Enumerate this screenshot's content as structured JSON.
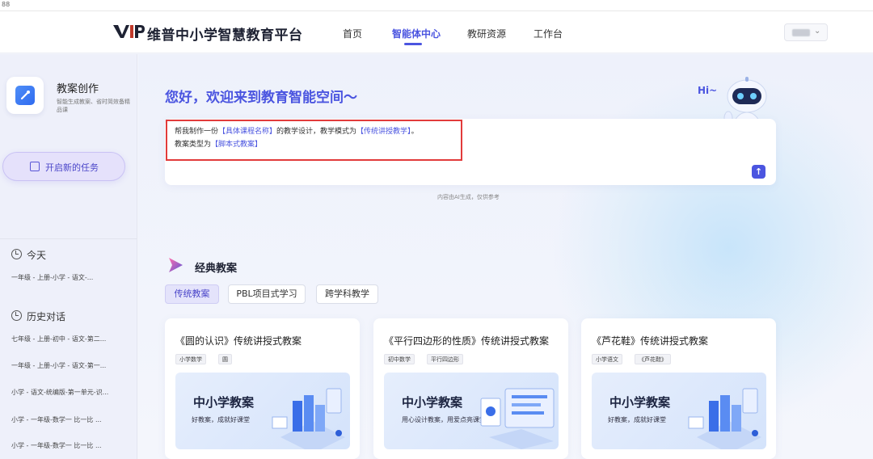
{
  "top_strip": {
    "text": "88"
  },
  "header": {
    "brand": "维普中小学智慧教育平台",
    "nav": [
      {
        "label": "首页",
        "active": false
      },
      {
        "label": "智能体中心",
        "active": true
      },
      {
        "label": "教研资源",
        "active": false
      },
      {
        "label": "工作台",
        "active": false
      }
    ],
    "user_menu_icon": "chevron-down-icon"
  },
  "sidebar": {
    "app_title": "教案创作",
    "app_desc": "智能生成教案、省时简效备精品课",
    "new_task_label": "开启新的任务",
    "today_title": "今天",
    "today_items": [
      "一年级 - 上册-小学 - 语文-..."
    ],
    "history_title": "历史对话",
    "history_items": [
      "七年级 - 上册-初中 - 语文-第二...",
      "一年级 - 上册-小学 - 语文-第一...",
      "小学 - 语文-统编版-第一单元-识...",
      "小学 - 一年级-数学一 比一比 ...",
      "小学 - 一年级-数学一 比一比 ..."
    ]
  },
  "main": {
    "greeting": "您好，欢迎来到教育智能空间～",
    "hi": "Hi~",
    "prompt": {
      "line1_a": "帮我制作一份",
      "line1_tag1": "【具体课程名称】",
      "line1_b": "的教学设计，教学模式为",
      "line1_tag2": "【传统讲授教学】",
      "line1_c": "。",
      "line2_a": "教案类型为",
      "line2_tag": "【脚本式教案】"
    },
    "send_icon": "arrow-up-icon",
    "note": "内容由AI生成，仅供参考",
    "classic_title": "经典教案",
    "tabs": [
      "传统教案",
      "PBL项目式学习",
      "跨学科教学"
    ],
    "active_tab": 0,
    "cards": [
      {
        "title": "《圆的认识》传统讲授式教案",
        "tags": [
          "小学数学",
          "圆"
        ],
        "banner_title": "中小学教案",
        "banner_sub": "好教案，成就好课堂"
      },
      {
        "title": "《平行四边形的性质》传统讲授式教案",
        "tags": [
          "初中数学",
          "平行四边形"
        ],
        "banner_title": "中小学教案",
        "banner_sub": "用心设计教案，用爱点亮课堂"
      },
      {
        "title": "《芦花鞋》传统讲授式教案",
        "tags": [
          "小学语文",
          "《芦花鞋》"
        ],
        "banner_title": "中小学教案",
        "banner_sub": "好教案，成就好课堂"
      }
    ]
  },
  "colors": {
    "accent": "#4b55e0",
    "highlight_border": "#e23b3b"
  }
}
